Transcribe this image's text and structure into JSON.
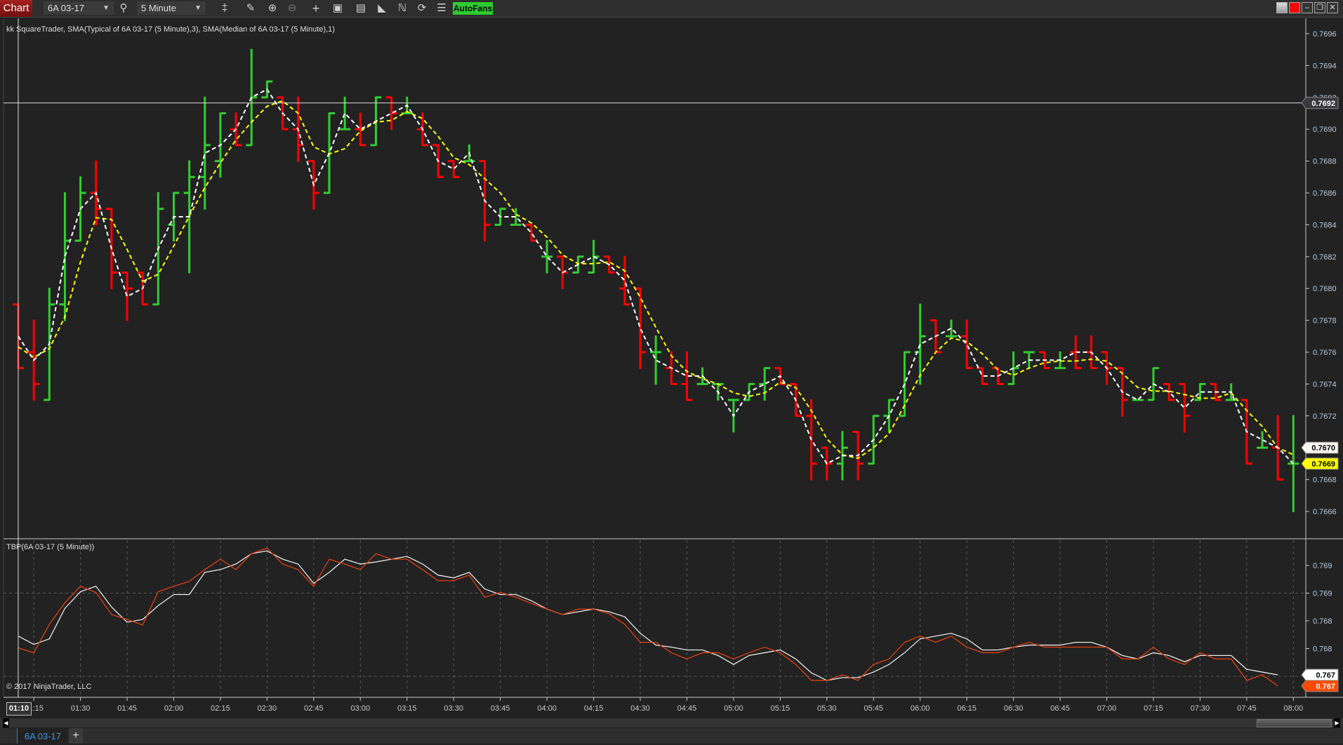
{
  "toolbar": {
    "chart_label": "Chart",
    "instrument": "6A 03-17",
    "interval": "5 Minute",
    "autofans": "AutoFans",
    "icons": [
      "search-icon",
      "bar-type-icon",
      "pencil-icon",
      "zoom-in-icon",
      "zoom-out-icon",
      "crosshair-icon",
      "data-box-icon",
      "bar-spacing-icon",
      "template-icon",
      "strategy-icon",
      "reload-icon",
      "properties-icon"
    ]
  },
  "window_controls": [
    "link-gray",
    "link-red",
    "minimize",
    "restore",
    "close"
  ],
  "main_panel": {
    "indicator_label": "kk SquareTrader, SMA(Typical of 6A 03-17 (5 Minute),3), SMA(Median of 6A 03-17 (5 Minute),1)",
    "price_ticks": [
      0.7696,
      0.7694,
      0.7692,
      0.769,
      0.7688,
      0.7686,
      0.7684,
      0.7682,
      0.768,
      0.7678,
      0.7676,
      0.7674,
      0.7672,
      0.767,
      0.7668,
      0.7666
    ],
    "price_tick_labels": [
      "0.7696",
      "0.7694",
      "0.7692",
      "0.7690",
      "0.7688",
      "0.7686",
      "0.7684",
      "0.7682",
      "0.7680",
      "0.7678",
      "0.7676",
      "0.7674",
      "0.7672",
      "0.7670",
      "0.7668",
      "0.7666"
    ],
    "crosshair": {
      "price": 0.7692,
      "label": "0.7692",
      "time_label": "01:10"
    },
    "markers": [
      {
        "value": 0.767,
        "label": "0.7670",
        "bg": "#fdf5f0",
        "fg": "#000000"
      },
      {
        "value": 0.7669,
        "label": "0.7669",
        "bg": "#ffff00",
        "fg": "#000000"
      }
    ]
  },
  "lower_panel": {
    "label": "TBP(6A 03-17 (5 Minute))",
    "copyright": "© 2017 NinjaTrader, LLC",
    "ticks": [
      0.769,
      0.7686,
      0.7682,
      0.7678
    ],
    "tick_labels": [
      "0.769",
      "0.769",
      "0.768",
      "0.768"
    ],
    "gridlines": [
      0.7686,
      0.7674
    ],
    "markers": [
      {
        "value": 0.76742,
        "label": "0.767",
        "bg": "#ffffff",
        "fg": "#000000"
      },
      {
        "value": 0.76726,
        "label": "0.767",
        "bg": "#ff4a00",
        "fg": "#ffffff"
      }
    ]
  },
  "time_axis": {
    "labels": [
      "01:15",
      "01:30",
      "01:45",
      "02:00",
      "02:15",
      "02:30",
      "02:45",
      "03:00",
      "03:15",
      "03:30",
      "03:45",
      "04:00",
      "04:15",
      "04:30",
      "04:45",
      "05:00",
      "05:15",
      "05:30",
      "05:45",
      "06:00",
      "06:15",
      "06:30",
      "06:45",
      "07:00",
      "07:15",
      "07:30",
      "07:45",
      "08:00"
    ]
  },
  "tabs": [
    {
      "label": "6A 03-17",
      "active": true
    }
  ],
  "add_tab_label": "+",
  "colors": {
    "up": "#32cd32",
    "down": "#ff0000",
    "sma_typical": "#ffff00",
    "sma_median": "#ffffff",
    "tbp_1": "#e8e8e8",
    "tbp_2": "#e04010",
    "background": "#222222"
  },
  "chart_data": [
    {
      "type": "ohlc",
      "instrument": "6A 03-17",
      "interval": "5 Minute",
      "times": [
        "01:10",
        "01:15",
        "01:20",
        "01:25",
        "01:30",
        "01:35",
        "01:40",
        "01:45",
        "01:50",
        "01:55",
        "02:00",
        "02:05",
        "02:10",
        "02:15",
        "02:20",
        "02:25",
        "02:30",
        "02:35",
        "02:40",
        "02:45",
        "02:50",
        "02:55",
        "03:00",
        "03:05",
        "03:10",
        "03:15",
        "03:20",
        "03:25",
        "03:30",
        "03:35",
        "03:40",
        "03:45",
        "03:50",
        "03:55",
        "04:00",
        "04:05",
        "04:10",
        "04:15",
        "04:20",
        "04:25",
        "04:30",
        "04:35",
        "04:40",
        "04:45",
        "04:50",
        "04:55",
        "05:00",
        "05:05",
        "05:10",
        "05:15",
        "05:20",
        "05:25",
        "05:30",
        "05:35",
        "05:40",
        "05:45",
        "05:50",
        "05:55",
        "06:00",
        "06:05",
        "06:10",
        "06:15",
        "06:20",
        "06:25",
        "06:30",
        "06:35",
        "06:40",
        "06:45",
        "06:50",
        "06:55",
        "07:00",
        "07:05",
        "07:10",
        "07:15",
        "07:20",
        "07:25",
        "07:30",
        "07:35",
        "07:40",
        "07:45",
        "07:50",
        "07:55",
        "08:00"
      ],
      "ohlc": [
        [
          0.7679,
          0.7679,
          0.7675,
          0.7675
        ],
        [
          0.7676,
          0.7678,
          0.7673,
          0.7674
        ],
        [
          0.7673,
          0.768,
          0.7673,
          0.7679
        ],
        [
          0.7679,
          0.7686,
          0.7678,
          0.7683
        ],
        [
          0.7683,
          0.7687,
          0.7683,
          0.7686
        ],
        [
          0.7686,
          0.7688,
          0.7684,
          0.7685
        ],
        [
          0.7685,
          0.7685,
          0.768,
          0.7681
        ],
        [
          0.7681,
          0.7681,
          0.7678,
          0.768
        ],
        [
          0.7681,
          0.7681,
          0.7679,
          0.7679
        ],
        [
          0.7679,
          0.7686,
          0.7679,
          0.7685
        ],
        [
          0.7684,
          0.7686,
          0.7683,
          0.7686
        ],
        [
          0.7686,
          0.7688,
          0.7681,
          0.7687
        ],
        [
          0.7687,
          0.7692,
          0.7685,
          0.7689
        ],
        [
          0.7688,
          0.7691,
          0.7687,
          0.7691
        ],
        [
          0.769,
          0.7691,
          0.7689,
          0.7689
        ],
        [
          0.7689,
          0.7695,
          0.7689,
          0.7692
        ],
        [
          0.7692,
          0.7693,
          0.7692,
          0.7693
        ],
        [
          0.7692,
          0.7692,
          0.769,
          0.769
        ],
        [
          0.769,
          0.7692,
          0.7688,
          0.7689
        ],
        [
          0.7688,
          0.7688,
          0.7685,
          0.7686
        ],
        [
          0.7686,
          0.7691,
          0.7686,
          0.7691
        ],
        [
          0.769,
          0.7692,
          0.769,
          0.769
        ],
        [
          0.769,
          0.7691,
          0.7689,
          0.7689
        ],
        [
          0.7689,
          0.7692,
          0.7689,
          0.7692
        ],
        [
          0.7692,
          0.7692,
          0.769,
          0.7691
        ],
        [
          0.7691,
          0.7692,
          0.7691,
          0.7691
        ],
        [
          0.769,
          0.7691,
          0.7689,
          0.7689
        ],
        [
          0.7689,
          0.7689,
          0.7687,
          0.7687
        ],
        [
          0.7688,
          0.7688,
          0.7687,
          0.7687
        ],
        [
          0.7688,
          0.7689,
          0.7688,
          0.7688
        ],
        [
          0.7688,
          0.7688,
          0.7683,
          0.7684
        ],
        [
          0.7684,
          0.7685,
          0.7684,
          0.7685
        ],
        [
          0.7684,
          0.7685,
          0.7684,
          0.7684
        ],
        [
          0.7684,
          0.7684,
          0.7683,
          0.7683
        ],
        [
          0.7682,
          0.7683,
          0.7681,
          0.7682
        ],
        [
          0.7682,
          0.7682,
          0.768,
          0.7681
        ],
        [
          0.7681,
          0.7682,
          0.7681,
          0.7682
        ],
        [
          0.7681,
          0.7683,
          0.7681,
          0.7682
        ],
        [
          0.7682,
          0.7682,
          0.7681,
          0.7681
        ],
        [
          0.768,
          0.7682,
          0.7679,
          0.7679
        ],
        [
          0.768,
          0.768,
          0.7675,
          0.7676
        ],
        [
          0.7676,
          0.7677,
          0.7674,
          0.7676
        ],
        [
          0.7675,
          0.7676,
          0.7674,
          0.7674
        ],
        [
          0.7674,
          0.7676,
          0.7673,
          0.7673
        ],
        [
          0.7674,
          0.7675,
          0.7674,
          0.7674
        ],
        [
          0.7674,
          0.7674,
          0.7673,
          0.7674
        ],
        [
          0.7673,
          0.7673,
          0.7671,
          0.7673
        ],
        [
          0.7673,
          0.7674,
          0.7673,
          0.7674
        ],
        [
          0.7674,
          0.7675,
          0.7673,
          0.7675
        ],
        [
          0.7675,
          0.7675,
          0.7674,
          0.7674
        ],
        [
          0.7674,
          0.7674,
          0.7672,
          0.7672
        ],
        [
          0.7672,
          0.7673,
          0.7668,
          0.7669
        ],
        [
          0.767,
          0.767,
          0.7668,
          0.7669
        ],
        [
          0.7669,
          0.7671,
          0.7668,
          0.767
        ],
        [
          0.7671,
          0.7671,
          0.7668,
          0.7669
        ],
        [
          0.7669,
          0.7672,
          0.7669,
          0.7672
        ],
        [
          0.7672,
          0.7673,
          0.7671,
          0.7673
        ],
        [
          0.7672,
          0.7676,
          0.7672,
          0.7676
        ],
        [
          0.7676,
          0.7679,
          0.7674,
          0.7677
        ],
        [
          0.7678,
          0.7678,
          0.7676,
          0.7676
        ],
        [
          0.7677,
          0.7678,
          0.7677,
          0.7677
        ],
        [
          0.7677,
          0.7678,
          0.7675,
          0.7675
        ],
        [
          0.7675,
          0.7675,
          0.7674,
          0.7674
        ],
        [
          0.7675,
          0.7675,
          0.7674,
          0.7674
        ],
        [
          0.7674,
          0.7676,
          0.7674,
          0.7675
        ],
        [
          0.7676,
          0.7676,
          0.7675,
          0.7676
        ],
        [
          0.7676,
          0.7676,
          0.7675,
          0.7675
        ],
        [
          0.7675,
          0.7676,
          0.7675,
          0.7675
        ],
        [
          0.7676,
          0.7677,
          0.7675,
          0.7675
        ],
        [
          0.7676,
          0.7677,
          0.7675,
          0.7675
        ],
        [
          0.7676,
          0.7676,
          0.7674,
          0.7675
        ],
        [
          0.7675,
          0.7675,
          0.7672,
          0.7673
        ],
        [
          0.7673,
          0.7673,
          0.7673,
          0.7673
        ],
        [
          0.7673,
          0.7675,
          0.7673,
          0.7675
        ],
        [
          0.7674,
          0.7674,
          0.7673,
          0.7673
        ],
        [
          0.7674,
          0.7674,
          0.7671,
          0.7672
        ],
        [
          0.7673,
          0.7674,
          0.7673,
          0.7674
        ],
        [
          0.7674,
          0.7674,
          0.7673,
          0.7673
        ],
        [
          0.7673,
          0.7674,
          0.7673,
          0.7673
        ],
        [
          0.7673,
          0.7673,
          0.7669,
          0.7669
        ],
        [
          0.767,
          0.7671,
          0.767,
          0.767
        ],
        [
          0.767,
          0.7672,
          0.7668,
          0.7668
        ],
        [
          0.7669,
          0.7672,
          0.7666,
          0.7669
        ]
      ],
      "indicators": [
        {
          "name": "SMA(Typical of 6A 03-17 (5 Minute),3)",
          "source": "typical",
          "period": 3,
          "style": "dashed"
        },
        {
          "name": "SMA(Median of 6A 03-17 (5 Minute),1)",
          "source": "median",
          "period": 1,
          "style": "dashed"
        }
      ],
      "ylim": [
        0.7665,
        0.76975
      ]
    },
    {
      "type": "line",
      "title": "TBP(6A 03-17 (5 Minute))",
      "series": [
        {
          "values": [
            0.76798,
            0.76786,
            0.76794,
            0.76838,
            0.76862,
            0.7687,
            0.7684,
            0.76818,
            0.76822,
            0.76842,
            0.76858,
            0.76858,
            0.7689,
            0.76894,
            0.76902,
            0.76917,
            0.76921,
            0.76909,
            0.76902,
            0.76874,
            0.7689,
            0.76909,
            0.76902,
            0.76905,
            0.76909,
            0.76913,
            0.76902,
            0.76886,
            0.76882,
            0.7689,
            0.76866,
            0.76858,
            0.76858,
            0.76849,
            0.76837,
            0.76829,
            0.76833,
            0.76837,
            0.76833,
            0.76826,
            0.76802,
            0.76785,
            0.76782,
            0.76778,
            0.76778,
            0.7677,
            0.76757,
            0.7677,
            0.76774,
            0.76778,
            0.76765,
            0.76745,
            0.76734,
            0.76738,
            0.76738,
            0.76746,
            0.76757,
            0.76774,
            0.76794,
            0.76798,
            0.76802,
            0.76794,
            0.76778,
            0.76778,
            0.76782,
            0.76785,
            0.76785,
            0.76785,
            0.76789,
            0.76789,
            0.76782,
            0.7677,
            0.76765,
            0.76774,
            0.7677,
            0.76761,
            0.7677,
            0.7677,
            0.7677,
            0.7675,
            0.76746,
            0.76742,
            null
          ]
        },
        {
          "values": [
            0.76781,
            0.76774,
            0.76815,
            0.76846,
            0.7687,
            0.76861,
            0.76829,
            0.76822,
            0.76814,
            0.76862,
            0.7687,
            0.76877,
            0.76894,
            0.76909,
            0.76894,
            0.76917,
            0.76925,
            0.76902,
            0.76894,
            0.7687,
            0.76909,
            0.76902,
            0.76894,
            0.76917,
            0.76909,
            0.76909,
            0.76894,
            0.76878,
            0.76878,
            0.76886,
            0.76854,
            0.76861,
            0.76854,
            0.76845,
            0.76837,
            0.76829,
            0.76837,
            0.76837,
            0.7683,
            0.76815,
            0.76789,
            0.76789,
            0.76774,
            0.76765,
            0.76774,
            0.76774,
            0.76765,
            0.76774,
            0.76782,
            0.76774,
            0.76757,
            0.76734,
            0.76734,
            0.76742,
            0.76734,
            0.76757,
            0.76765,
            0.76789,
            0.76798,
            0.76789,
            0.76798,
            0.76782,
            0.76774,
            0.76774,
            0.76782,
            0.76789,
            0.76782,
            0.76782,
            0.76782,
            0.76782,
            0.76782,
            0.76765,
            0.76765,
            0.76782,
            0.76765,
            0.76757,
            0.76774,
            0.76765,
            0.76765,
            0.76734,
            0.76742,
            0.76726,
            null
          ]
        }
      ]
    }
  ]
}
